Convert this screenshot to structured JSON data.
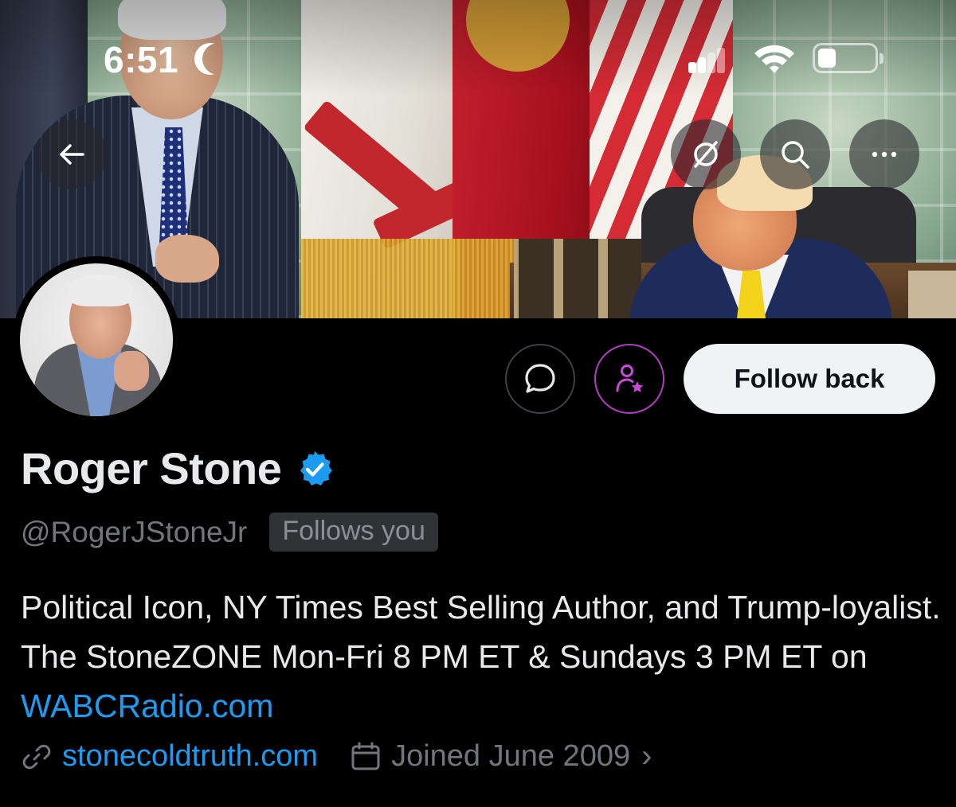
{
  "status_bar": {
    "time": "6:51"
  },
  "banner": {
    "description_icons": [
      "back-arrow-icon",
      "grok-icon",
      "search-icon",
      "more-icon"
    ]
  },
  "profile": {
    "name": "Roger Stone",
    "handle": "@RogerJStoneJr",
    "follows_you": "Follows you",
    "bio_text": "Political Icon, NY Times Best Selling Author, and Trump-loyalist. The StoneZONE Mon-Fri 8 PM ET & Sundays 3 PM ET on ",
    "bio_link": "WABCRadio.com",
    "website": "stonecoldtruth.com",
    "joined": "Joined June 2009",
    "chevron": "›"
  },
  "actions": {
    "follow_label": "Follow back"
  },
  "colors": {
    "link": "#1d9bf0",
    "verified": "#1d9bf0",
    "subscribe_accent": "#b23ec4",
    "muted": "#71767b"
  }
}
